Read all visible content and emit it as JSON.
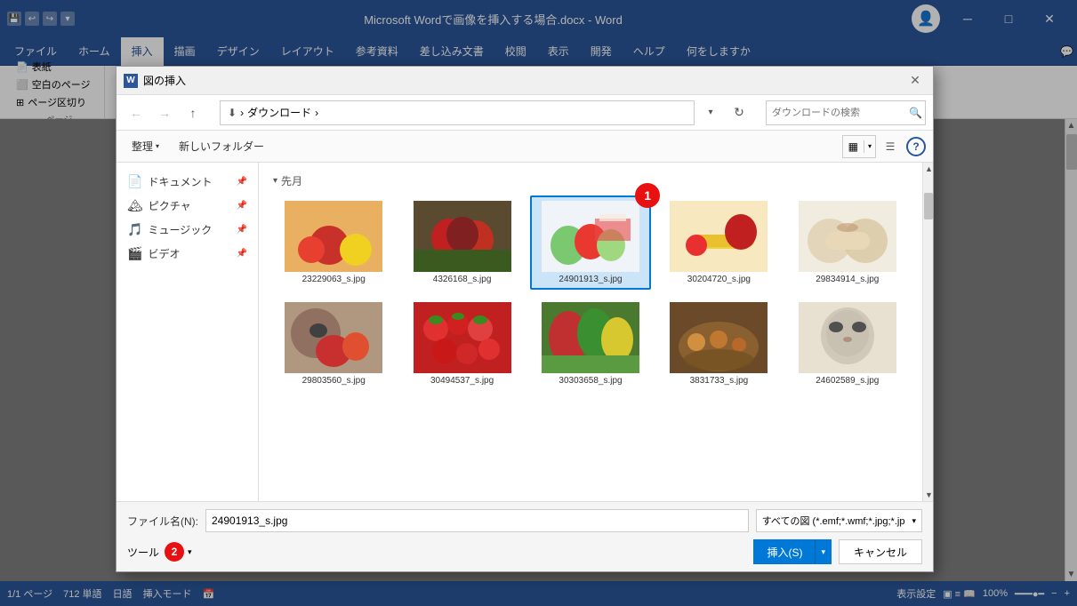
{
  "titlebar": {
    "title": "Microsoft Wordで画像を挿入する場合.docx  -  Word",
    "user_icon": "👤",
    "min_label": "─",
    "max_label": "□",
    "close_label": "✕"
  },
  "ribbon": {
    "tabs": [
      {
        "id": "file",
        "label": "ファイル"
      },
      {
        "id": "home",
        "label": "ホーム"
      },
      {
        "id": "insert",
        "label": "挿入",
        "active": true
      },
      {
        "id": "draw",
        "label": "描画"
      },
      {
        "id": "design",
        "label": "デザイン"
      },
      {
        "id": "layout",
        "label": "レイアウト"
      },
      {
        "id": "references",
        "label": "参考資料"
      },
      {
        "id": "mailings",
        "label": "差し込み文書"
      },
      {
        "id": "review",
        "label": "校閲"
      },
      {
        "id": "view",
        "label": "表示"
      },
      {
        "id": "dev",
        "label": "開発"
      },
      {
        "id": "help",
        "label": "ヘルプ"
      },
      {
        "id": "q",
        "label": "何をしますか"
      }
    ],
    "search_placeholder": "何をしますか"
  },
  "toolbar": {
    "items": [
      {
        "id": "hyoshi",
        "label": "表紙"
      },
      {
        "id": "blank",
        "label": "空白のページ"
      },
      {
        "id": "pagebreak",
        "label": "ページ区切り"
      }
    ],
    "group_label": "ページ"
  },
  "dialog": {
    "title": "図の挿入",
    "title_icon": "W",
    "close_btn": "✕",
    "navbar": {
      "back_tooltip": "戻る",
      "forward_tooltip": "進む",
      "up_tooltip": "上へ",
      "path_parts": [
        "ダウンロード"
      ],
      "path_separator": "›",
      "refresh_tooltip": "最新の情報に更新",
      "search_placeholder": "ダウンロードの検索"
    },
    "toolbar": {
      "organize_label": "整理",
      "new_folder_label": "新しいフォルダー"
    },
    "sidebar": {
      "items": [
        {
          "id": "documents",
          "label": "ドキュメント",
          "icon": "📄",
          "pinned": true
        },
        {
          "id": "pictures",
          "label": "ピクチャ",
          "icon": "🏔",
          "pinned": true
        },
        {
          "id": "music",
          "label": "ミュージック",
          "icon": "🎵",
          "pinned": true
        },
        {
          "id": "video",
          "label": "ビデオ",
          "icon": "🎬",
          "pinned": true
        }
      ]
    },
    "files": {
      "section_label": "先月",
      "items": [
        {
          "id": "1",
          "name": "23229063_s.jpg",
          "thumb_class": "thumb-1"
        },
        {
          "id": "2",
          "name": "4326168_s.jpg",
          "thumb_class": "thumb-2"
        },
        {
          "id": "3",
          "name": "24901913_s.jpg",
          "thumb_class": "thumb-3",
          "selected": true
        },
        {
          "id": "4",
          "name": "30204720_s.jpg",
          "thumb_class": "thumb-4"
        },
        {
          "id": "5",
          "name": "29834914_s.jpg",
          "thumb_class": "thumb-5"
        },
        {
          "id": "6",
          "name": "29803560_s.jpg",
          "thumb_class": "thumb-6"
        },
        {
          "id": "7",
          "name": "30494537_s.jpg",
          "thumb_class": "thumb-7"
        },
        {
          "id": "8",
          "name": "30303658_s.jpg",
          "thumb_class": "thumb-8"
        },
        {
          "id": "9",
          "name": "3831733_s.jpg",
          "thumb_class": "thumb-9"
        },
        {
          "id": "10",
          "name": "24602589_s.jpg",
          "thumb_class": "thumb-10"
        }
      ]
    },
    "footer": {
      "filename_label": "ファイル名(N):",
      "filename_value": "24901913_s.jpg",
      "filetype_label": "すべての図 (*.emf;*.wmf;*.jpg;*.jp",
      "tools_label": "ツール",
      "insert_label": "挿入(S)",
      "cancel_label": "キャンセル"
    }
  },
  "annotations": {
    "circle1_label": "1",
    "circle2_label": "2"
  },
  "statusbar": {
    "page_info": "1/1 ページ",
    "word_count": "712 単語",
    "language": "日語",
    "mode": "挿入モード",
    "display_settings": "表示設定",
    "zoom": "100%"
  }
}
